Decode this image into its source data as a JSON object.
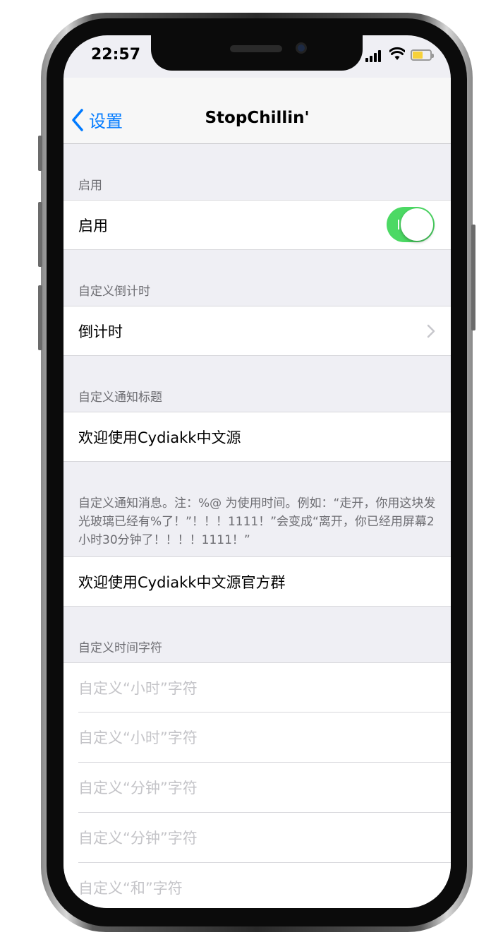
{
  "status_bar": {
    "time": "22:57"
  },
  "navbar": {
    "back_label": "设置",
    "title": "StopChillin'"
  },
  "sections": {
    "enable": {
      "header": "启用",
      "row_label": "启用",
      "toggle_on": true
    },
    "countdown": {
      "header": "自定义倒计时",
      "row_label": "倒计时"
    },
    "notify_title": {
      "header": "自定义通知标题",
      "value": "欢迎使用Cydiakk中文源"
    },
    "notify_message": {
      "note": "自定义通知消息。注：%@ 为使用时间。例如：“走开，你用这块发光玻璃已经有%了！”！！！1111！”会变成“离开，你已经用屏幕2小时30分钟了！！！！1111！”",
      "value": "欢迎使用Cydiakk中文源官方群"
    },
    "time_strings": {
      "header": "自定义时间字符",
      "placeholders": [
        "自定义“小时”字符",
        "自定义“小时”字符",
        "自定义“分钟”字符",
        "自定义“分钟”字符",
        "自定义“和”字符"
      ]
    }
  },
  "colors": {
    "accent": "#007aff",
    "toggle_on": "#4cd964",
    "background": "#efeff4",
    "battery": "#f7d13a"
  }
}
